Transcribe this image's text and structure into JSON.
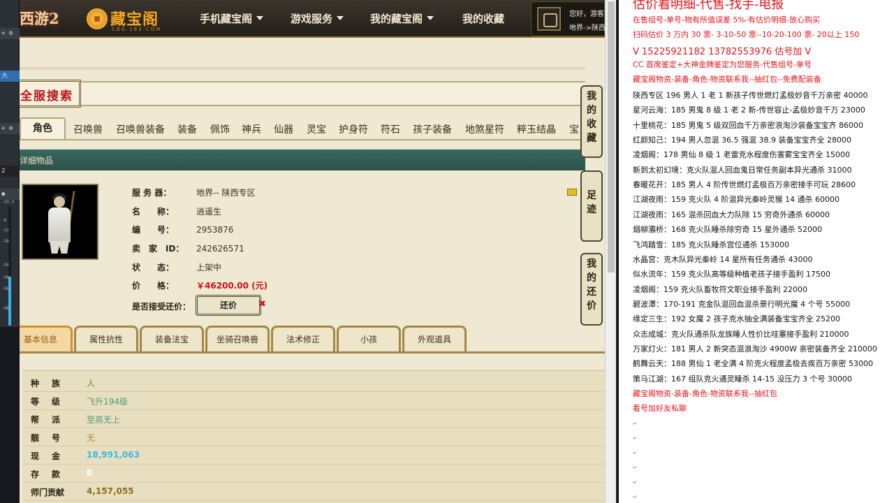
{
  "mixer": {
    "labels": [
      "大",
      "2"
    ],
    "ticks": [
      "-23.3",
      "-6",
      "-12",
      "-18",
      "-24",
      "-30",
      "-36",
      "-48"
    ]
  },
  "header": {
    "game_logo": "西游2",
    "cbg_logo": "藏宝阁",
    "cbg_sub": "CBG.163.COM",
    "nav": [
      {
        "label": "手机藏宝阁",
        "caret": true
      },
      {
        "label": "游戏服务",
        "caret": true
      },
      {
        "label": "我的藏宝阁",
        "caret": true
      },
      {
        "label": "我的收藏",
        "caret": false
      }
    ],
    "user_greeting": "您好，游客",
    "user_server": "地界->陕西"
  },
  "search": {
    "badge": "全服搜索"
  },
  "tabs": [
    "角色",
    "召唤兽",
    "召唤兽装备",
    "装备",
    "佩饰",
    "神兵",
    "仙器",
    "灵宝",
    "护身符",
    "符石",
    "孩子装备",
    "地煞星符",
    "粹玉结晶",
    "宝"
  ],
  "detail": {
    "bar_title": "详细物品",
    "fields": [
      {
        "label": "服 务 器：",
        "value": "地界-- 陕西专区"
      },
      {
        "label": "名　　称：",
        "value": "逍遥生"
      },
      {
        "label": "编　　号：",
        "value": "2953876"
      },
      {
        "label": "卖　家　ID：",
        "value": "242626571"
      },
      {
        "label": "状　　态：",
        "value": "上架中"
      },
      {
        "label": "价　　格：",
        "value": "￥46200.00 (元)"
      }
    ],
    "counter_label": "是否接受还价：",
    "counter_button": "还价",
    "counter_x": "✖"
  },
  "side_tabs": [
    "我的收藏",
    "足迹",
    "我的还价"
  ],
  "sub_tabs": [
    "基本信息",
    "属性抗性",
    "装备法宝",
    "坐骑召唤兽",
    "法术修正",
    "小孩",
    "外观道具"
  ],
  "attributes": [
    {
      "key": "种族",
      "value": "人",
      "color": "#8a7a3a"
    },
    {
      "key": "等级",
      "value": "飞升194级",
      "color": "#4f9a78"
    },
    {
      "key": "帮派",
      "value": "至高无上",
      "color": "#4f9a78"
    },
    {
      "key": "靓号",
      "value": "无",
      "color": "#b88b2a"
    },
    {
      "key": "现金",
      "value": "18,991,063",
      "color": "#39b7e0"
    },
    {
      "key": "存款",
      "value": "0",
      "color": "#ffffff"
    },
    {
      "key": "师门贡献",
      "value": "4,157,055",
      "color": "#8a6a1e"
    }
  ],
  "notes": {
    "top_partial": "估价看明细-代售-找手-电报",
    "watermark": "",
    "lines": [
      {
        "text": "在售组号-单号-物有所值误差 5%-有估价明细-放心购买",
        "red": true
      },
      {
        "text": "扫码估价 3 万内 30 票- 3-10-50 票--10-20-100 票- 20以上 150",
        "red": true
      },
      {
        "text": "V 15225921182   13782553976   估号加 V",
        "red": true,
        "big": true
      },
      {
        "text": "CC 首席鉴定+大神金牌鉴定为您服务-代售组号-单号",
        "red": true
      },
      {
        "text": "藏宝阁物资-装备-角色-物资联系我--抽红包--免费配装备",
        "red": true
      },
      {
        "text": "陕西专区 196 男人 1 老 1 新孩子传世燃灯孟极妙音千万亲密 40000",
        "red": false
      },
      {
        "text": "星河云海：185 男鬼 8 级 1 老 2 新-传世容止-孟极妙音千万 23000",
        "red": false
      },
      {
        "text": "十里桃花：185 男鬼 5 级双回血千万亲密浪淘沙装备宝宝齐 86000",
        "red": false
      },
      {
        "text": "红颜知己：194 男人忽混 36.5 强混 38.9 装备宝宝齐全 28000",
        "red": false
      },
      {
        "text": "凌烟阁：178 男仙 8 级 1 老雷克水程度伤害雾宝宝齐全 15000",
        "red": false
      },
      {
        "text": "新到太初幻境：克火队混人回血鬼日常任务副本异光通杀 31000",
        "red": false
      },
      {
        "text": "春暖花开：185 男人 4 阶传世燃灯孟极百万亲密接手可玩 28600",
        "red": false
      },
      {
        "text": "江湖夜雨：159 克火队 4 阶混异光秦岭灵猴 14 通杀 60000",
        "red": false
      },
      {
        "text": "江湖夜雨：165 混杀回血大力队除 15 穷奇外通杀 60000",
        "red": false
      },
      {
        "text": "烟柳灞桥：168 克火队睡杀除穷奇 15 星外通杀 52000",
        "red": false
      },
      {
        "text": "飞鸿踏雪：185 克火队睡杀宫位通杀 153000",
        "red": false
      },
      {
        "text": "水晶宫：克木队异光秦岭 14 星所有任务通杀 43000",
        "red": false
      },
      {
        "text": "似水流年：159 克火队高等级种植老孩子接手盈利 17500",
        "red": false
      },
      {
        "text": "凌烟阁：159 克火队畜牧符文职业接手盈利 22000",
        "red": false
      },
      {
        "text": "碧波潭：170-191 克金队混回血混杀景行明光魔 4 个号 55000",
        "red": false
      },
      {
        "text": "缘定三生：192 女魔 2 孩子克水抽全满装备宝宝齐全 25200",
        "red": false
      },
      {
        "text": "众志成城：克火队通杀队龙族睡人性价比哇塞接手盈利 210000",
        "red": false
      },
      {
        "text": "万家灯火：181 男人 2 新突态混浪淘沙 4900W 亲密装备齐全 210000",
        "red": false
      },
      {
        "text": "鹤舞云天：188 男仙 1 老全满 4 阶克火程度孟极去疾百万亲密 53000",
        "red": false
      },
      {
        "text": "策马江湖：167 组队克火通灵睡杀 14-15 没压力 3 个号 30000",
        "red": false
      },
      {
        "text": "藏宝阁物资-装备-角色-物资联系我--抽红包",
        "red": true
      },
      {
        "text": "看号加好友私聊",
        "red": true
      }
    ]
  }
}
